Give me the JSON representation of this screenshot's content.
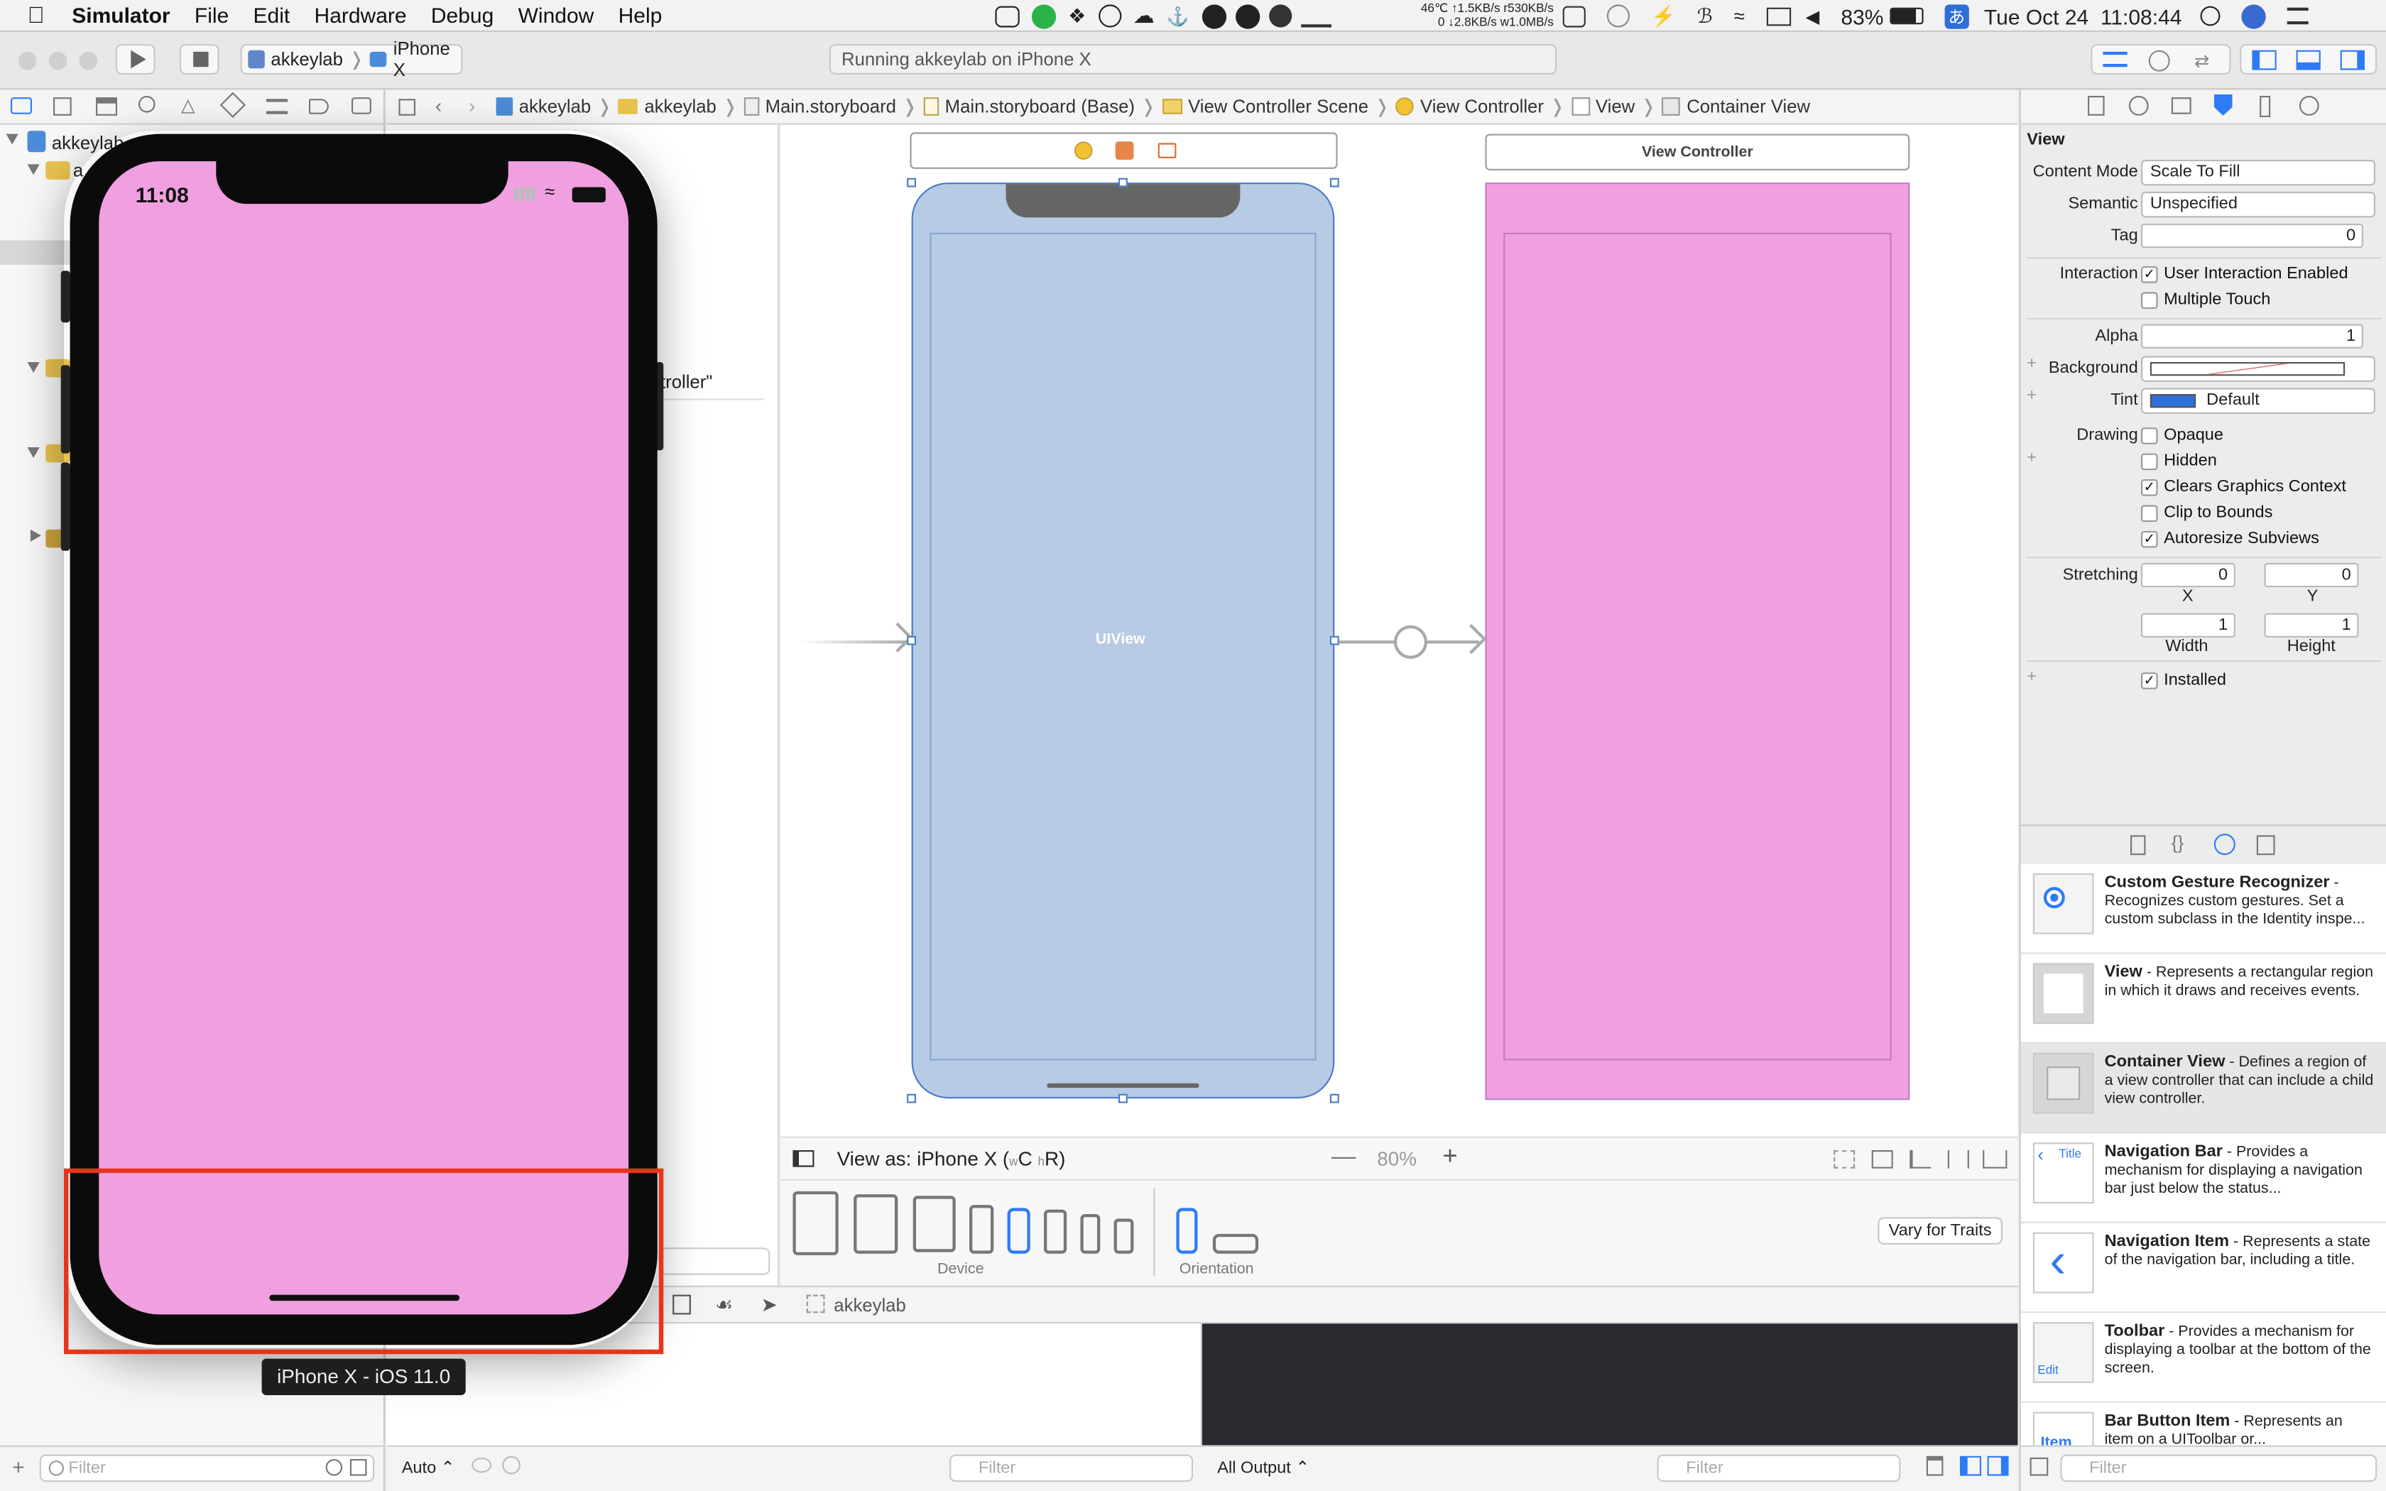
{
  "menubar": {
    "app": "Simulator",
    "items": [
      "File",
      "Edit",
      "Hardware",
      "Debug",
      "Window",
      "Help"
    ],
    "netstats": "46℃ ↑1.5KB/s r530KB/s",
    "netstats2": "0 ↓2.8KB/s w1.0MB/s",
    "battery": "83%",
    "ime": "あ",
    "clock": "Tue Oct 24  11:08:44"
  },
  "toolbar": {
    "scheme": "akkeylab",
    "device": "iPhone X",
    "status": "Running akkeylab on iPhone X"
  },
  "jumpbar": [
    "akkeylab",
    "akkeylab",
    "Main.storyboard",
    "Main.storyboard (Base)",
    "View Controller Scene",
    "View Controller",
    "View",
    "Container View"
  ],
  "navigator": {
    "root": "akkeylab",
    "child": "a"
  },
  "outline": {
    "partial_label": "troller\""
  },
  "canvas": {
    "uiview_label": "UIView",
    "vc_title": "View Controller",
    "view_as": "View as: iPhone X (",
    "size_class_w": "w",
    "size_class_c": "C",
    "size_class_h": "h",
    "size_class_r": "R)",
    "zoom": "80%",
    "device_label": "Device",
    "orientation_label": "Orientation",
    "vary_traits": "Vary for Traits"
  },
  "debugbar": {
    "target": "akkeylab"
  },
  "bottom": {
    "filter": "Filter",
    "auto": "Auto ⌃",
    "output": "All Output ⌃"
  },
  "simulator": {
    "time": "11:08",
    "label": "iPhone X - iOS 11.0",
    "screen_color": "#f0a0e0"
  },
  "inspector": {
    "section": "View",
    "content_mode_label": "Content Mode",
    "content_mode": "Scale To Fill",
    "semantic_label": "Semantic",
    "semantic": "Unspecified",
    "tag_label": "Tag",
    "tag": "0",
    "interaction_label": "Interaction",
    "user_interaction": "User Interaction Enabled",
    "multiple_touch": "Multiple Touch",
    "alpha_label": "Alpha",
    "alpha": "1",
    "background_label": "Background",
    "tint_label": "Tint",
    "tint": "Default",
    "drawing_label": "Drawing",
    "opaque": "Opaque",
    "hidden": "Hidden",
    "clears": "Clears Graphics Context",
    "clip": "Clip to Bounds",
    "autoresize": "Autoresize Subviews",
    "stretching_label": "Stretching",
    "stretch_x": "0",
    "stretch_y": "0",
    "x_label": "X",
    "y_label": "Y",
    "stretch_w": "1",
    "stretch_h": "1",
    "width_label": "Width",
    "height_label": "Height",
    "installed": "Installed"
  },
  "library": [
    {
      "title": "Custom Gesture Recognizer",
      "desc": " - Recognizes custom gestures. Set a custom subclass in the Identity inspe..."
    },
    {
      "title": "View",
      "desc": " - Represents a rectangular region in which it draws and receives events."
    },
    {
      "title": "Container View",
      "desc": " - Defines a region of a view controller that can include a child view controller."
    },
    {
      "title": "Navigation Bar",
      "desc": " - Provides a mechanism for displaying a navigation bar just below the status..."
    },
    {
      "title": "Navigation Item",
      "desc": " - Represents a state of the navigation bar, including a title."
    },
    {
      "title": "Toolbar",
      "desc": " - Provides a mechanism for displaying a toolbar at the bottom of the screen."
    },
    {
      "title": "Bar Button Item",
      "desc": " - Represents an item on a UIToolbar or..."
    }
  ],
  "library_thumb_labels": {
    "nav_bar_title": "Title",
    "toolbar_edit": "Edit",
    "bar_item": "Item"
  },
  "colors": {
    "accent": "#2f7bf5",
    "pink": "#f0a0e0",
    "annotation": "#e8341c",
    "storyboard_blue": "#b8cbe4"
  }
}
